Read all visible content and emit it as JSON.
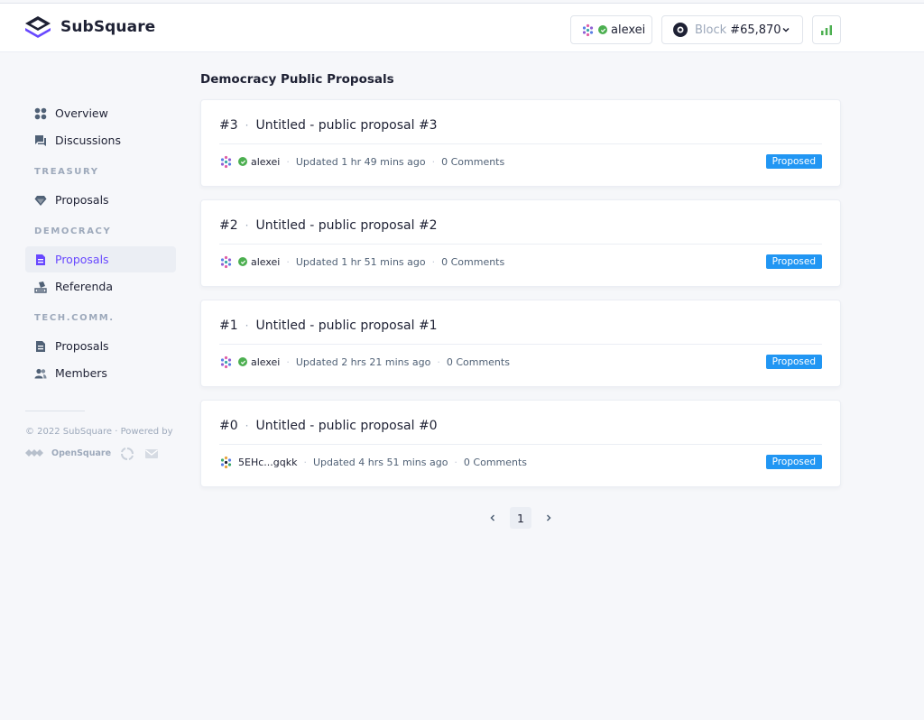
{
  "header": {
    "brand": "SubSquare",
    "user": {
      "name": "alexei"
    },
    "block": {
      "label": "Block",
      "number": "#65,870"
    },
    "stats_icon": "signal-bars-icon"
  },
  "sidebar": {
    "items": [
      {
        "label": "Overview",
        "icon": "grid-icon"
      },
      {
        "label": "Discussions",
        "icon": "chat-icon"
      }
    ],
    "treasury": {
      "heading": "TREASURY",
      "items": [
        {
          "label": "Proposals",
          "icon": "gem-icon"
        }
      ]
    },
    "democracy": {
      "heading": "DEMOCRACY",
      "items": [
        {
          "label": "Proposals",
          "icon": "document-icon"
        },
        {
          "label": "Referenda",
          "icon": "vote-icon"
        }
      ]
    },
    "techcomm": {
      "heading": "TECH.COMM.",
      "items": [
        {
          "label": "Proposals",
          "icon": "document-icon"
        },
        {
          "label": "Members",
          "icon": "people-icon"
        }
      ]
    },
    "footer": {
      "copyright": "© 2022 SubSquare · Powered by",
      "powered_by": "OpenSquare"
    }
  },
  "main": {
    "title": "Democracy Public Proposals",
    "proposals": [
      {
        "index": "#3",
        "title": "Untitled - public proposal #3",
        "author": "alexei",
        "updated": "Updated 1 hr 49 mins ago",
        "comments": "0 Comments",
        "status": "Proposed"
      },
      {
        "index": "#2",
        "title": "Untitled - public proposal #2",
        "author": "alexei",
        "updated": "Updated 1 hr 51 mins ago",
        "comments": "0 Comments",
        "status": "Proposed"
      },
      {
        "index": "#1",
        "title": "Untitled - public proposal #1",
        "author": "alexei",
        "updated": "Updated 2 hrs 21 mins ago",
        "comments": "0 Comments",
        "status": "Proposed"
      },
      {
        "index": "#0",
        "title": "Untitled - public proposal #0",
        "author": "5EHc...gqkk",
        "updated": "Updated 4 hrs 51 mins ago",
        "comments": "0 Comments",
        "status": "Proposed"
      }
    ],
    "pagination": {
      "current": "1"
    }
  },
  "colors": {
    "accent": "#6848ff",
    "badge": "#2196f3",
    "verified": "#4caf50",
    "stats": "#4caf50"
  }
}
